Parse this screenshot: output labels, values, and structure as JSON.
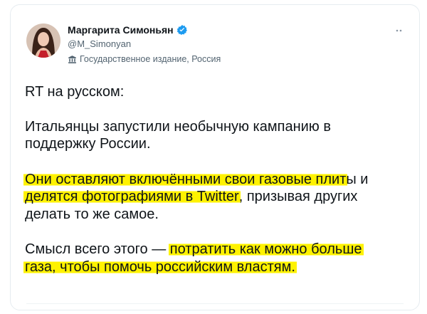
{
  "author": {
    "display_name": "Маргарита Симоньян",
    "handle": "@M_Simonyan",
    "affiliation": "Государственное издание, Россия",
    "avatar_icon": "avatar-photo",
    "verified_icon": "verified-badge-icon"
  },
  "tweet": {
    "line1": "RT на русском:",
    "p2_line1": "Итальянцы запустили необычную кампанию в",
    "p2_line2": "поддержку России.",
    "p3_line1_hl": "Они оставляют включёнными свои газовые плит",
    "p3_line1_rest": "ы и",
    "p3_line2_hl": "делятся фотографиями в Twitter",
    "p3_line2_rest": ", призывая других",
    "p3_line3": "делать то же самое.",
    "p4_line1_pre": "Смысл всего этого — ",
    "p4_line1_hl": "потратить как можно больше",
    "p4_line2_hl": "газа, чтобы помочь российским властям."
  },
  "colors": {
    "highlight": "#fff200",
    "verified": "#1d9bf0",
    "muted_text": "#536471"
  }
}
